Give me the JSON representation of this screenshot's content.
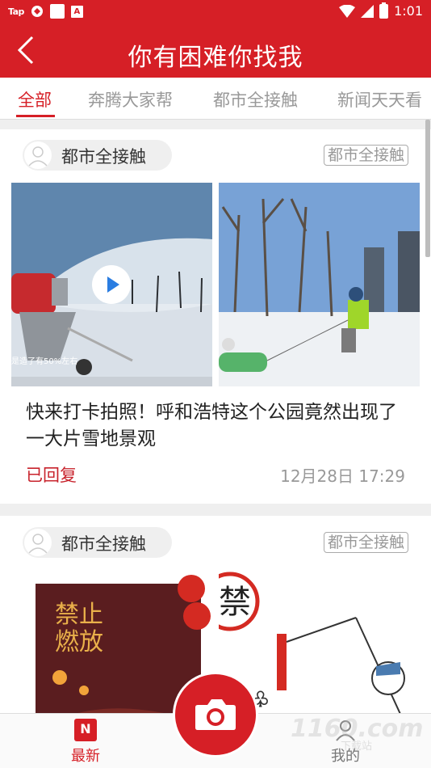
{
  "status_bar": {
    "carrier": "Tap",
    "time": "1:01"
  },
  "header": {
    "title": "你有困难你找我"
  },
  "tabs": [
    {
      "label": "全部",
      "active": true
    },
    {
      "label": "奔腾大家帮",
      "active": false
    },
    {
      "label": "都市全接触",
      "active": false
    },
    {
      "label": "新闻天天看",
      "active": false
    }
  ],
  "posts": [
    {
      "source_name": "都市全接触",
      "source_tag": "都市全接触",
      "video_overlay_text": "是造了有50%左右",
      "title": "快来打卡拍照！呼和浩特这个公园竟然出现了一大片雪地景观",
      "status": "已回复",
      "time": "12月28日 17:29"
    },
    {
      "source_name": "都市全接触",
      "source_tag": "都市全接触",
      "poster_text": "禁止燃放"
    }
  ],
  "bottom_nav": {
    "latest_label": "最新",
    "latest_icon_letter": "N",
    "mine_label": "我的"
  },
  "watermark": {
    "main": "1160.com",
    "sub": "下载站"
  },
  "colors": {
    "brand_red": "#d61f26",
    "status_red": "#c8232c"
  }
}
